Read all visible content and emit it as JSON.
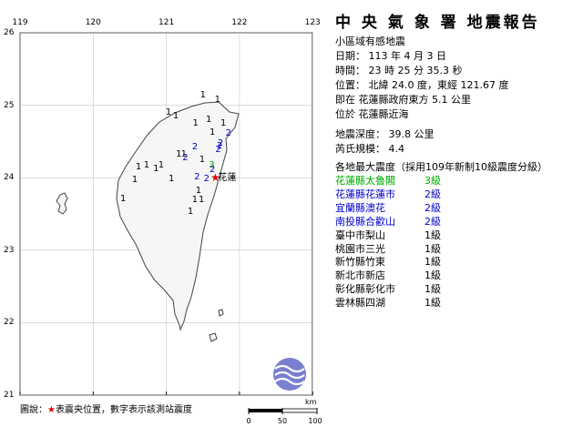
{
  "map": {
    "lon_labels": [
      {
        "text": "119",
        "lon": 119
      },
      {
        "text": "120",
        "lon": 120
      },
      {
        "text": "121",
        "lon": 121
      },
      {
        "text": "122",
        "lon": 122
      },
      {
        "text": "123",
        "lon": 123
      }
    ],
    "lat_labels": [
      {
        "text": "26",
        "lat": 26
      },
      {
        "text": "25",
        "lat": 25
      },
      {
        "text": "24",
        "lat": 24
      },
      {
        "text": "23",
        "lat": 23
      },
      {
        "text": "22",
        "lat": 22
      },
      {
        "text": "21",
        "lat": 21
      }
    ],
    "epicenter": {
      "lat": 24.0,
      "lon": 121.67,
      "name": "花蓮",
      "color": "#e00000"
    },
    "stations": [
      {
        "value": "1",
        "lat": 25.13,
        "lon": 121.5,
        "color": "#000000"
      },
      {
        "value": "1",
        "lat": 25.07,
        "lon": 121.7,
        "color": "#000000"
      },
      {
        "value": "1",
        "lat": 24.84,
        "lon": 121.13,
        "color": "#000000"
      },
      {
        "value": "1",
        "lat": 24.9,
        "lon": 121.03,
        "color": "#000000"
      },
      {
        "value": "1",
        "lat": 24.75,
        "lon": 121.4,
        "color": "#000000"
      },
      {
        "value": "1",
        "lat": 24.8,
        "lon": 121.58,
        "color": "#000000"
      },
      {
        "value": "1",
        "lat": 24.74,
        "lon": 121.78,
        "color": "#000000"
      },
      {
        "value": "2",
        "lat": 24.6,
        "lon": 121.85,
        "color": "#0000cc"
      },
      {
        "value": "1",
        "lat": 24.62,
        "lon": 121.63,
        "color": "#000000"
      },
      {
        "value": "2",
        "lat": 24.42,
        "lon": 121.39,
        "color": "#0000cc"
      },
      {
        "value": "2",
        "lat": 24.47,
        "lon": 121.74,
        "color": "#0000cc"
      },
      {
        "value": "2",
        "lat": 24.43,
        "lon": 121.73,
        "color": "#0000cc"
      },
      {
        "value": "2",
        "lat": 24.38,
        "lon": 121.71,
        "color": "#0000cc"
      },
      {
        "value": "1",
        "lat": 24.32,
        "lon": 121.17,
        "color": "#000000"
      },
      {
        "value": "1",
        "lat": 24.32,
        "lon": 121.24,
        "color": "#000000"
      },
      {
        "value": "2",
        "lat": 24.27,
        "lon": 121.26,
        "color": "#0000cc"
      },
      {
        "value": "1",
        "lat": 24.24,
        "lon": 121.49,
        "color": "#000000"
      },
      {
        "value": "3",
        "lat": 24.17,
        "lon": 121.62,
        "color": "#00aa00"
      },
      {
        "value": "2",
        "lat": 24.1,
        "lon": 121.63,
        "color": "#0000cc"
      },
      {
        "value": "1",
        "lat": 24.17,
        "lon": 120.93,
        "color": "#000000"
      },
      {
        "value": "1",
        "lat": 24.17,
        "lon": 120.73,
        "color": "#000000"
      },
      {
        "value": "1",
        "lat": 24.14,
        "lon": 120.62,
        "color": "#000000"
      },
      {
        "value": "1",
        "lat": 24.12,
        "lon": 120.86,
        "color": "#000000"
      },
      {
        "value": "2",
        "lat": 24.0,
        "lon": 121.42,
        "color": "#0000cc"
      },
      {
        "value": "2",
        "lat": 23.98,
        "lon": 121.55,
        "color": "#0000cc"
      },
      {
        "value": "1",
        "lat": 23.98,
        "lon": 121.07,
        "color": "#000000"
      },
      {
        "value": "1",
        "lat": 23.96,
        "lon": 120.57,
        "color": "#000000"
      },
      {
        "value": "1",
        "lat": 23.82,
        "lon": 121.44,
        "color": "#000000"
      },
      {
        "value": "1",
        "lat": 23.69,
        "lon": 121.39,
        "color": "#000000"
      },
      {
        "value": "1",
        "lat": 23.69,
        "lon": 121.48,
        "color": "#000000"
      },
      {
        "value": "1",
        "lat": 23.7,
        "lon": 120.41,
        "color": "#000000"
      },
      {
        "value": "1",
        "lat": 23.52,
        "lon": 121.33,
        "color": "#000000"
      }
    ],
    "legend": {
      "prefix": "圖說：",
      "star": "★",
      "text": "表震央位置，數字表示該測站震度"
    },
    "scale": {
      "unit": "km",
      "ticks": [
        "0",
        "50",
        "100"
      ]
    },
    "colors": {
      "sea": "#ffffff",
      "land": "#f6f6f6",
      "coast": "#444444",
      "grid": "#bbbbbb",
      "logo": "#7a7fd0"
    }
  },
  "report": {
    "title": "中 央 氣 象 署 地震報告",
    "subtitle": "小區域有感地震",
    "date": "日期： 113 年 4 月 3 日",
    "time": "時間： 23 時 25 分 35.3 秒",
    "location": "位置： 北緯 24.0 度，東經 121.67 度",
    "relative_1": "即在 花蓮縣政府東方 5.1 公里",
    "relative_2": "位於 花蓮縣近海",
    "depth": "地震深度： 39.8 公里",
    "magnitude": "芮氏規模： 4.4",
    "intensity_header": "各地最大震度（採用109年新制10級震度分級）",
    "intensities": [
      {
        "area": "花蓮縣太魯閣",
        "level": "3級",
        "color": "#00aa00"
      },
      {
        "area": "花蓮縣花蓮市",
        "level": "2級",
        "color": "#0000cc"
      },
      {
        "area": "宜蘭縣澳花",
        "level": "2級",
        "color": "#0000cc"
      },
      {
        "area": "南投縣合歡山",
        "level": "2級",
        "color": "#0000cc"
      },
      {
        "area": "臺中市梨山",
        "level": "1級",
        "color": "#000000"
      },
      {
        "area": "桃園市三光",
        "level": "1級",
        "color": "#000000"
      },
      {
        "area": "新竹縣竹東",
        "level": "1級",
        "color": "#000000"
      },
      {
        "area": "新北市新店",
        "level": "1級",
        "color": "#000000"
      },
      {
        "area": "彰化縣彰化市",
        "level": "1級",
        "color": "#000000"
      },
      {
        "area": "雲林縣四湖",
        "level": "1級",
        "color": "#000000"
      }
    ]
  }
}
